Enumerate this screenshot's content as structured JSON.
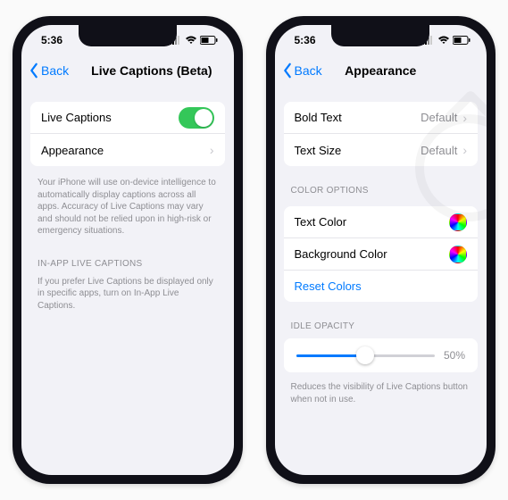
{
  "status": {
    "time": "5:36"
  },
  "left": {
    "back": "Back",
    "title": "Live Captions (Beta)",
    "rows": {
      "live_captions": "Live Captions",
      "appearance": "Appearance"
    },
    "footer1": "Your iPhone will use on-device intelligence to automatically display captions across all apps. Accuracy of Live Captions may vary and should not be relied upon in high-risk or emergency situations.",
    "section2": "IN-APP LIVE CAPTIONS",
    "footer2": "If you prefer Live Captions be displayed only in specific apps, turn on In-App Live Captions."
  },
  "right": {
    "back": "Back",
    "title": "Appearance",
    "rows": {
      "bold_text": "Bold Text",
      "bold_text_value": "Default",
      "text_size": "Text Size",
      "text_size_value": "Default"
    },
    "color_section": "COLOR OPTIONS",
    "color_rows": {
      "text_color": "Text Color",
      "background_color": "Background Color",
      "reset": "Reset Colors"
    },
    "opacity_section": "IDLE OPACITY",
    "opacity_value": "50%",
    "opacity_footer": "Reduces the visibility of Live Captions button when not in use."
  }
}
